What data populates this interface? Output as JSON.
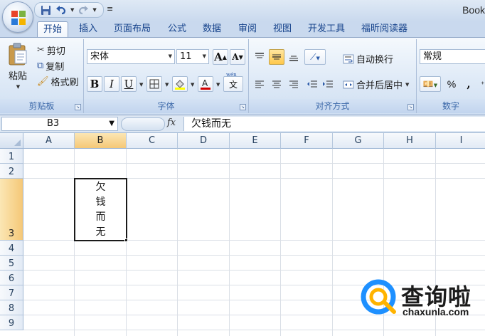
{
  "window": {
    "title": "Book"
  },
  "tabs": [
    "开始",
    "插入",
    "页面布局",
    "公式",
    "数据",
    "审阅",
    "视图",
    "开发工具",
    "福昕阅读器"
  ],
  "ribbon": {
    "clipboard": {
      "paste": "粘贴",
      "cut": "剪切",
      "copy": "复制",
      "format_painter": "格式刷",
      "label": "剪贴板"
    },
    "font": {
      "name": "宋体",
      "size": "11",
      "bold": "B",
      "italic": "I",
      "underline": "U",
      "grow": "A",
      "shrink": "A",
      "label": "字体",
      "phonetic": "wén"
    },
    "alignment": {
      "wrap_text": "自动换行",
      "merge_center": "合并后居中",
      "label": "对齐方式"
    },
    "number": {
      "format": "常规",
      "percent": "%",
      "comma": ",",
      "label": "数字"
    }
  },
  "formula_bar": {
    "name_box": "B3",
    "fx": "fx",
    "content": "欠钱而无"
  },
  "columns": [
    "A",
    "B",
    "C",
    "D",
    "E",
    "F",
    "G",
    "H",
    "I"
  ],
  "rows": [
    "1",
    "2",
    "3",
    "4",
    "5",
    "6",
    "7",
    "8",
    "9"
  ],
  "active": {
    "column": "B",
    "row": "3"
  },
  "cells": {
    "B3": [
      "欠",
      "钱",
      "而",
      "无"
    ]
  },
  "watermark": {
    "name": "查询啦",
    "url": "chaxunla.com"
  },
  "colors": {
    "accent": "#15428b",
    "selected_header": "#f5c877",
    "font_red": "#d40000",
    "highlight": "#ffff00",
    "watermark_blue": "#1e90ff"
  }
}
